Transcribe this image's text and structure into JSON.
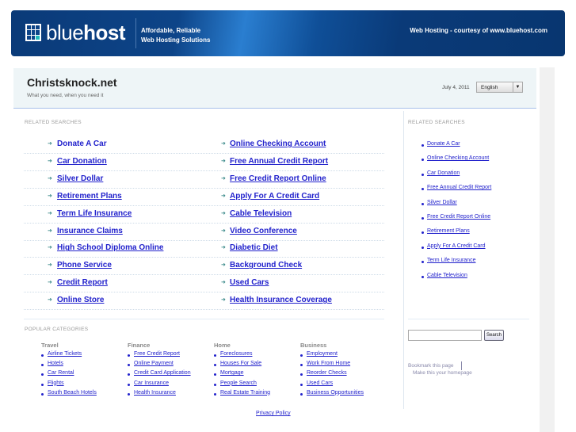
{
  "banner": {
    "logo_light": "blue",
    "logo_bold": "host",
    "tagline_1": "Affordable, Reliable",
    "tagline_2": "Web Hosting Solutions",
    "courtesy": "Web Hosting - courtesy of www.bluehost.com"
  },
  "header": {
    "title": "Christsknock.net",
    "subtitle": "What you need, when you need it",
    "date": "July 4, 2011",
    "language": "English"
  },
  "main": {
    "label": "RELATED SEARCHES",
    "left": [
      "Donate A Car",
      "Car Donation",
      "Silver Dollar",
      "Retirement Plans",
      "Term Life Insurance",
      "Insurance Claims",
      "High School Diploma Online",
      "Phone Service",
      "Credit Report",
      "Online Store"
    ],
    "right": [
      "Online Checking Account",
      "Free Annual Credit Report",
      "Free Credit Report Online",
      "Apply For A Credit Card",
      "Cable Television",
      "Video Conference",
      "Diabetic Diet",
      "Background Check",
      "Used Cars",
      "Health Insurance Coverage"
    ]
  },
  "sidebar": {
    "label": "RELATED SEARCHES",
    "links": [
      "Donate A Car",
      "Online Checking Account",
      "Car Donation",
      "Free Annual Credit Report",
      "Silver Dollar",
      "Free Credit Report Online",
      "Retirement Plans",
      "Apply For A Credit Card",
      "Term Life Insurance",
      "Cable Television"
    ],
    "search_button": "Search",
    "bookmark": "Bookmark this page",
    "homepage": "Make this your homepage"
  },
  "popular": {
    "label": "POPULAR CATEGORIES",
    "columns": [
      {
        "title": "Travel",
        "items": [
          "Airline Tickets",
          "Hotels",
          "Car Rental",
          "Flights",
          "South Beach Hotels"
        ]
      },
      {
        "title": "Finance",
        "items": [
          "Free Credit Report",
          "Online Payment",
          "Credit Card Application",
          "Car Insurance",
          "Health Insurance"
        ]
      },
      {
        "title": "Home",
        "items": [
          "Foreclosures",
          "Houses For Sale",
          "Mortgage",
          "People Search",
          "Real Estate Training"
        ]
      },
      {
        "title": "Business",
        "items": [
          "Employment",
          "Work From Home",
          "Reorder Checks",
          "Used Cars",
          "Business Opportunities"
        ]
      }
    ]
  },
  "footer": {
    "privacy": "Privacy Policy"
  }
}
